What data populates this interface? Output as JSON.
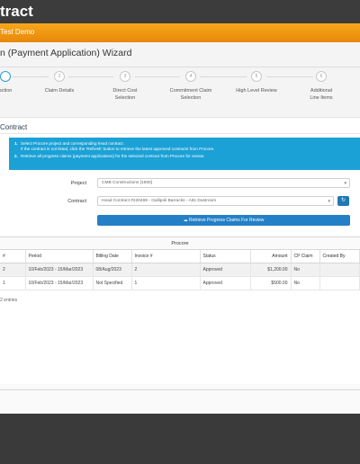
{
  "window": {
    "title": "tract"
  },
  "env": {
    "label": "Test Demo"
  },
  "wizard": {
    "title": "n (Payment Application) Wizard",
    "steps": [
      {
        "num": "",
        "label": "action"
      },
      {
        "num": "2",
        "label": "Claim Details"
      },
      {
        "num": "3",
        "label": "Direct Cost Selection"
      },
      {
        "num": "4",
        "label": "Commitment Claim Selection"
      },
      {
        "num": "5",
        "label": "High Level Review"
      },
      {
        "num": "6",
        "label": "Additional Line Items"
      }
    ]
  },
  "section": {
    "title": "Contract"
  },
  "info": {
    "items": [
      {
        "num": "1.",
        "text": "Select Procore project and corresponding head contract.",
        "sub": "If the contract is not listed, click the 'Refresh' button to retrieve the latest approved contracts from Procore."
      },
      {
        "num": "2.",
        "text": "Retrieve all progress claims (payment applications) for the selected contract from Procore for review.",
        "sub": ""
      }
    ]
  },
  "form": {
    "project_label": "Project",
    "project_value": "CMB Constructions [1550]",
    "contract_label": "Contract",
    "contract_value": "Head Contract #220469 - Gallipoli Barracks - A61 Dustroom",
    "retrieve_label": "Retrieve Progress Claims For Review"
  },
  "table": {
    "group_header": "Procore",
    "columns": [
      "#",
      "Period",
      "Billing Date",
      "Invoice #",
      "Status",
      "Amount",
      "CP Claim",
      "Created By"
    ],
    "rows": [
      [
        "2",
        "10/Feb/2023 - 15/Mar/2023",
        "08/Aug/2023",
        "2",
        "Approved",
        "$1,200.00",
        "No",
        ""
      ],
      [
        "1",
        "10/Feb/2023 - 15/Mar/2023",
        "Not Specified",
        "1",
        "Approved",
        "$500.00",
        "No",
        ""
      ]
    ],
    "entries_text": "2 entries"
  },
  "colors": {
    "accent": "#1ba1d6",
    "env_bar": "#f0961a",
    "button": "#2480c6"
  },
  "icons": {
    "caret": "chevron-down-icon",
    "refresh": "refresh-icon",
    "retrieve": "cloud-download-icon"
  }
}
